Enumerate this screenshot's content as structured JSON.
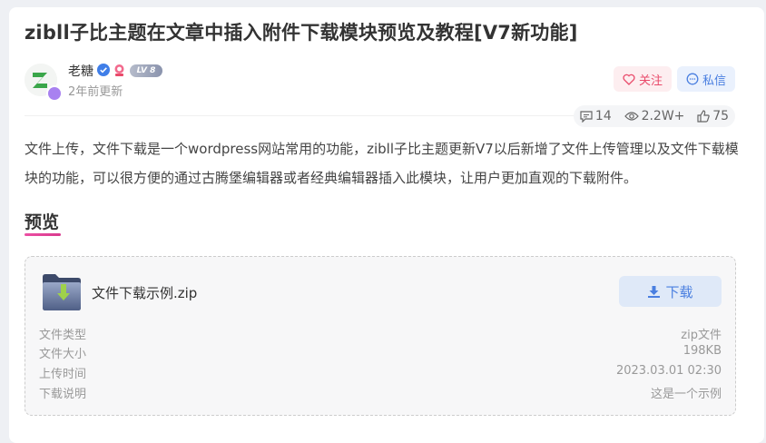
{
  "article": {
    "title": "zibll子比主题在文章中插入附件下载模块预览及教程[V7新功能]",
    "paragraph": "文件上传，文件下载是一个wordpress网站常用的功能，zibll子比主题更新V7以后新增了文件上传管理以及文件下载模块的功能，可以很方便的通过古腾堡编辑器或者经典编辑器插入此模块，让用户更加直观的下载附件。",
    "section_heading": "预览"
  },
  "author": {
    "name": "老糖",
    "level": "LV 8",
    "updated": "2年前更新",
    "icons": [
      "verified-icon",
      "medal-icon",
      "level-badge"
    ]
  },
  "actions": {
    "follow_label": "关注",
    "message_label": "私信"
  },
  "stats": {
    "comments": "14",
    "views": "2.2W+",
    "likes": "75"
  },
  "file": {
    "name": "文件下载示例.zip",
    "download_label": "下载",
    "details": [
      {
        "label": "文件类型",
        "value": "zip文件"
      },
      {
        "label": "文件大小",
        "value": "198KB"
      },
      {
        "label": "上传时间",
        "value": "2023.03.01 02:30"
      },
      {
        "label": "下载说明",
        "value": "这是一个示例"
      }
    ]
  },
  "colors": {
    "accent_pink": "#e94a6a",
    "accent_blue": "#4a7fe0",
    "heading_underline": "#ec4fa3"
  }
}
